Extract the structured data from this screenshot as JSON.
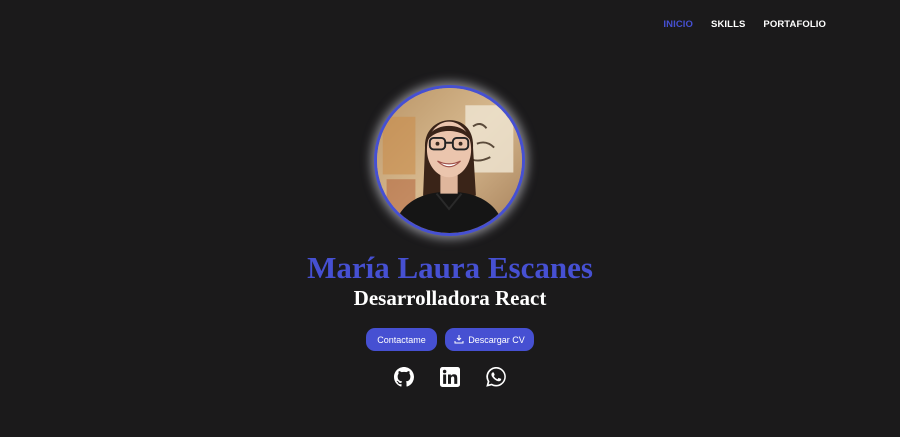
{
  "nav": {
    "items": [
      {
        "label": "INICIO",
        "active": true
      },
      {
        "label": "SKILLS",
        "active": false
      },
      {
        "label": "PORTAFOLIO",
        "active": false
      }
    ]
  },
  "hero": {
    "name": "María Laura Escanes",
    "role": "Desarrolladora React"
  },
  "buttons": {
    "contact_label": "Contactame",
    "cv_label": "Descargar CV"
  },
  "social": [
    "github-icon",
    "linkedin-icon",
    "whatsapp-icon"
  ],
  "colors": {
    "background": "#1b1a1b",
    "accent": "#4650d2",
    "text": "#ffffff"
  }
}
